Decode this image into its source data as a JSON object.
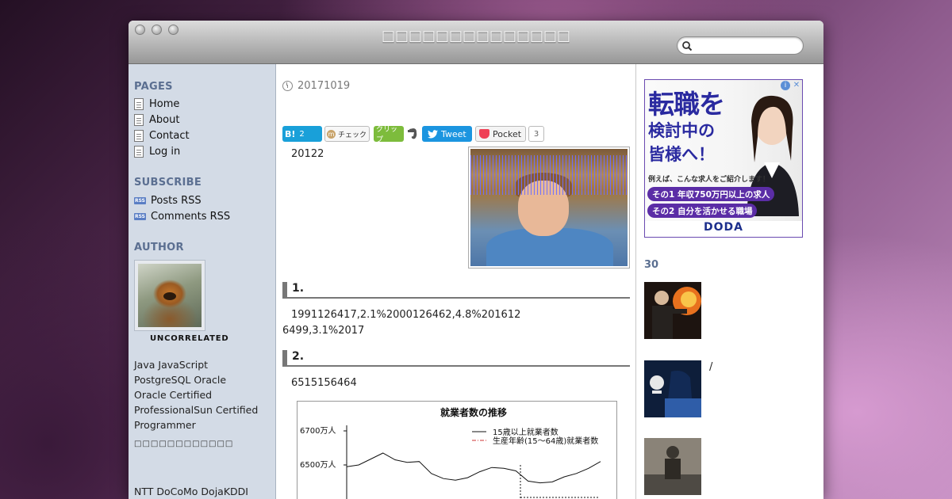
{
  "window": {
    "site_title": "□□□□□□□□□□□□□□",
    "search": {
      "placeholder": ""
    }
  },
  "left_sidebar": {
    "pages_heading": "PAGES",
    "pages": [
      "Home",
      "About",
      "Contact",
      "Log in"
    ],
    "subscribe_heading": "SUBSCRIBE",
    "subscribe": [
      "Posts RSS",
      "Comments RSS"
    ],
    "author_heading": "AUTHOR",
    "author_name": "UNCORRELATED",
    "bio_lines": [
      "Java JavaScript",
      "PostgreSQL Oracle",
      "Oracle Certified",
      "ProfessionalSun Certified",
      "Programmer"
    ],
    "bio_garbled": "□□□□□□□□□□□□",
    "bio_last": "NTT DoCoMo DojaKDDI"
  },
  "post": {
    "date": "20171019",
    "share": {
      "hatena_label": "B!",
      "hatena_count": "2",
      "mixi_label": "チェック",
      "clip_label": "クリップ",
      "tweet_label": "Tweet",
      "pocket_label": "Pocket",
      "pocket_count": "3"
    },
    "intro": "20122",
    "section1_heading": "1.",
    "section1_line1": "1991126417,2.1%2000126462,4.8%201612",
    "section1_line2": "6499,3.1%2017",
    "section2_heading": "2.",
    "section2_text": "6515156464"
  },
  "chart_data": {
    "type": "line",
    "title": "就業者数の推移",
    "y_ticks": [
      "6700万人",
      "6500万人"
    ],
    "ylim": [
      6400,
      6750
    ],
    "series": [
      {
        "name": "15歳以上就業者数",
        "style": "solid",
        "values": [
          6490,
          6500,
          6535,
          6570,
          6530,
          6515,
          6520,
          6450,
          6420,
          6410,
          6425,
          6460,
          6485,
          6480,
          6465,
          6405,
          6395,
          6400,
          6430,
          6450,
          6480,
          6520
        ]
      },
      {
        "name": "生産年齢(15〜64歳)就業者数",
        "style": "dash-dot"
      }
    ]
  },
  "right_sidebar": {
    "ad": {
      "line1": "転職を",
      "line2": "検討中の",
      "line3": "皆様へ！",
      "sub": "例えば、こんな求人をご紹介します！",
      "pill1": "その1 年収750万円以上の求人",
      "pill2": "その2 自分を活かせる職場",
      "brand": "DODA",
      "info_icon": "info-icon",
      "close_icon": "close-icon"
    },
    "heading": "30",
    "thumb2_text": "/"
  },
  "colors": {
    "sidebar_bg": "#d3dbe6",
    "heading": "#5b6f91",
    "tweet": "#1b95e0",
    "hatena": "#19a0d9",
    "pocket": "#ef4056"
  }
}
